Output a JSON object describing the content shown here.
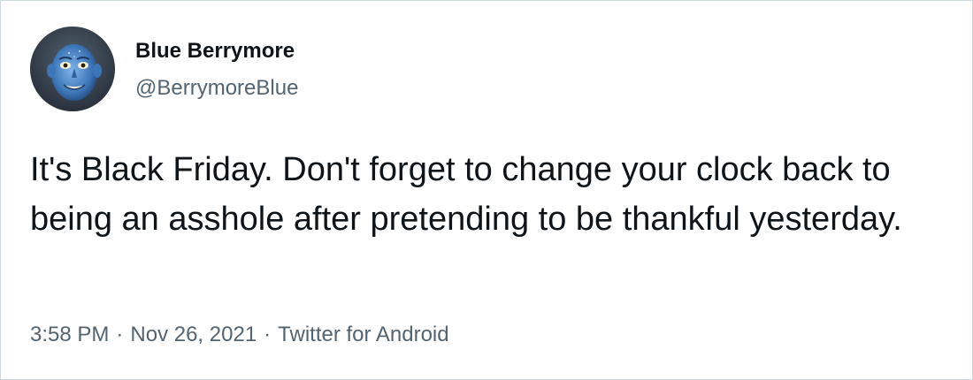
{
  "tweet": {
    "author": {
      "display_name": "Blue Berrymore",
      "handle": "@BerrymoreBlue",
      "avatar_icon": "avatar-blue-face-image"
    },
    "text": "It's Black Friday. Don't forget to change your clock back to being an asshole after pretending to be thankful yesterday.",
    "time": "3:58 PM",
    "date": "Nov 26, 2021",
    "source": "Twitter for Android",
    "separator": "·"
  },
  "colors": {
    "text_primary": "#0f1419",
    "text_secondary": "#536471",
    "border": "#cfd9de",
    "background": "#ffffff"
  }
}
